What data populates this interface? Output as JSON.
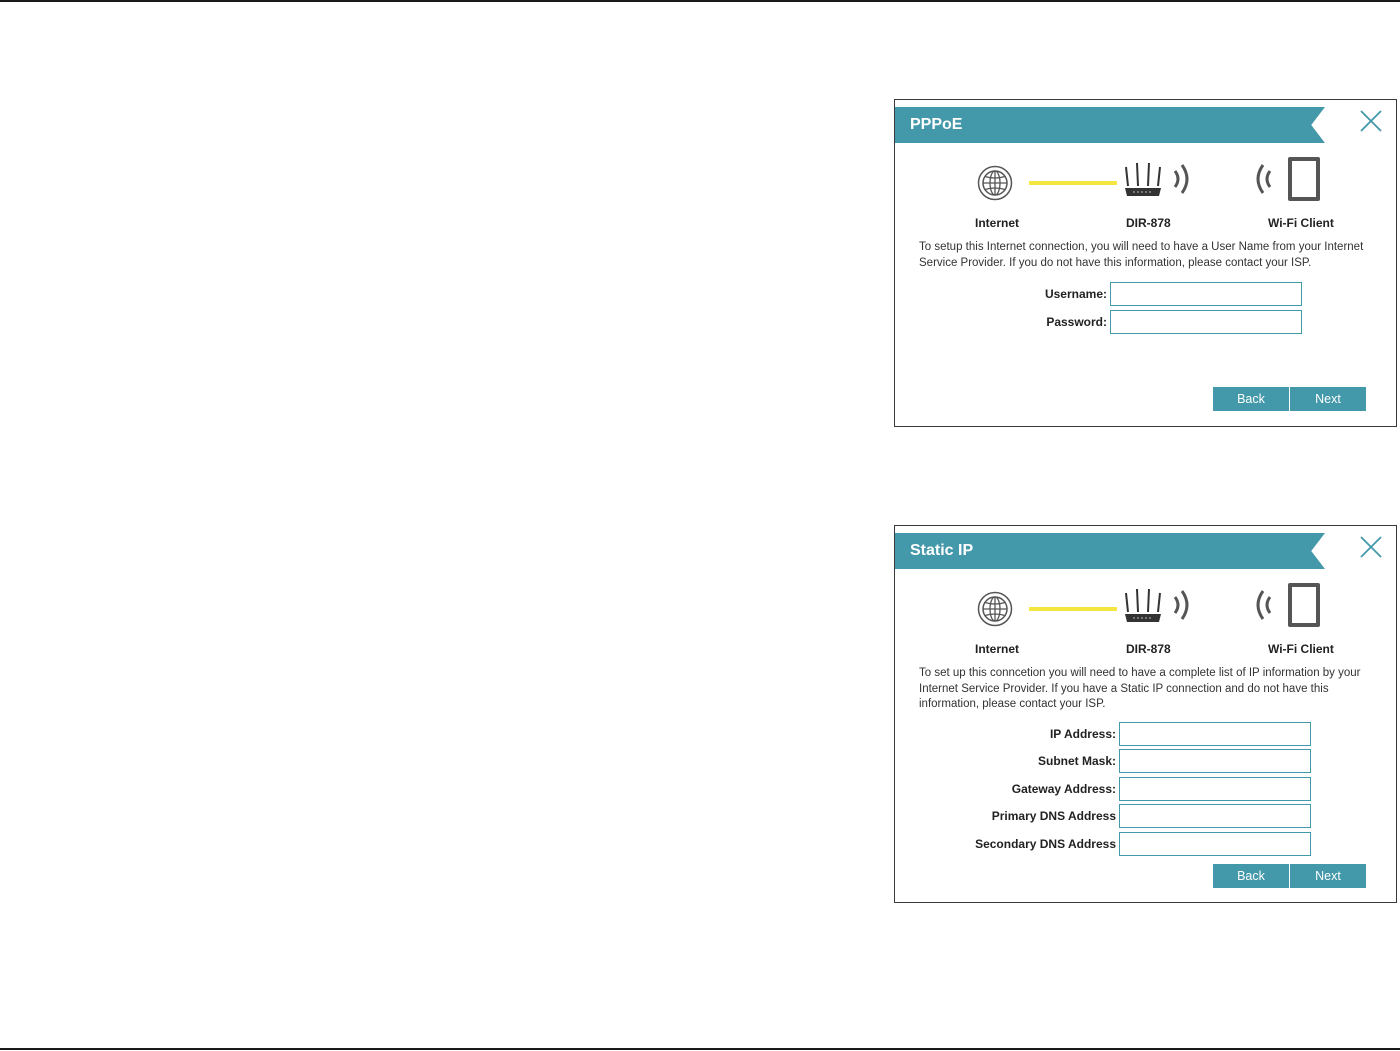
{
  "pppoe": {
    "title": "PPPoE",
    "diagram": {
      "internet": "Internet",
      "router": "DIR-878",
      "client": "Wi-Fi Client"
    },
    "description": "To setup this Internet connection, you will need to have a User Name from your Internet Service Provider. If you do not have this information, please contact your ISP.",
    "fields": [
      {
        "label": "Username:",
        "value": ""
      },
      {
        "label": "Password:",
        "value": ""
      }
    ],
    "back_label": "Back",
    "next_label": "Next"
  },
  "static_ip": {
    "title": "Static IP",
    "diagram": {
      "internet": "Internet",
      "router": "DIR-878",
      "client": "Wi-Fi Client"
    },
    "description": "To set up this conncetion you will need to have a complete list of IP information by your Internet Service Provider. If you have a Static IP connection and do not have this information, please contact your ISP.",
    "fields": [
      {
        "label": "IP Address:",
        "value": ""
      },
      {
        "label": "Subnet Mask:",
        "value": ""
      },
      {
        "label": "Gateway Address:",
        "value": ""
      },
      {
        "label": "Primary DNS Address",
        "value": ""
      },
      {
        "label": "Secondary DNS Address",
        "value": ""
      }
    ],
    "back_label": "Back",
    "next_label": "Next"
  },
  "colors": {
    "accent": "#4398aa",
    "link_line": "#f5e642",
    "icon": "#555555"
  }
}
